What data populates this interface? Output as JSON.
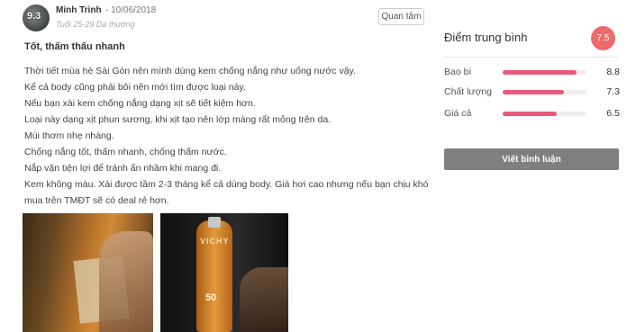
{
  "review": {
    "avatar_score": "9.3",
    "author": "Minh Trinh",
    "date": "- 10/06/2018",
    "meta": "Tuổi 25-29  Da thường",
    "follow_label": "Quan tâm",
    "title": "Tốt, thấm thấu nhanh",
    "body": [
      "Thời tiết mùa hè Sài Gòn nên mình dùng kem chống nắng như uống nước vậy.",
      "Kể cả body cũng phải bôi nên mới tìm được loại này.",
      "Nếu bạn xài kem chống nắng dạng xịt sẽ tiết kiệm hơn.",
      "Loại này dạng xịt phun sương, khi xịt tạo nên lớp màng rất mỏng trên da.",
      "Mùi thơm nhẹ nhàng.",
      "Chống nắng tốt, thấm nhanh, chống thấm nước.",
      "Nắp vặn tiện lợi để tránh ấn nhầm khi mang đi.",
      "Kem không màu. Xài được tầm 2-3 tháng kể cả dùng body. Giá hơi cao nhưng nếu bạn chịu khó mua trên TMĐT sẽ có deal rẻ hơn."
    ],
    "photo_text": {
      "brand": "VICHY",
      "spf": "50"
    }
  },
  "sidebar": {
    "summary_title": "Điểm trung bình",
    "overall_score": "7.5",
    "accent_color": "#ef6a6a",
    "bar_color": "#e85a7a",
    "ratings": [
      {
        "label": "Bao bì",
        "value": "8.8",
        "fraction": 0.88
      },
      {
        "label": "Chất lượng",
        "value": "7.3",
        "fraction": 0.73
      },
      {
        "label": "Giá cả",
        "value": "6.5",
        "fraction": 0.65
      }
    ],
    "write_button_label": "Viết bình luận"
  }
}
